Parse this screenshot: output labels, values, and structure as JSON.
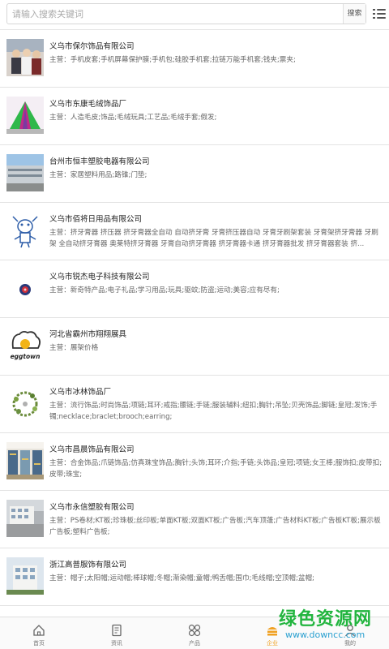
{
  "search": {
    "placeholder": "请输入搜索关键词",
    "button_label": "搜索"
  },
  "menu_icon": "list-menu-icon",
  "desc_prefix": "主营：",
  "companies": [
    {
      "name": "义乌市保尔饰品有限公司",
      "desc": "手机皮套;手机屏幕保护膜;手机包;硅胶手机套;拉链万能手机套;钱夹;票夹;"
    },
    {
      "name": "义乌市东康毛绒饰品厂",
      "desc": "人造毛皮;饰品;毛绒玩具;工艺品;毛绒手套;假发;"
    },
    {
      "name": "台州市恒丰塑胶电器有限公司",
      "desc": "家居塑料用品;路锥;门垫;"
    },
    {
      "name": "义乌市佰将日用品有限公司",
      "desc": "挤牙膏器 挤压器 挤牙膏器全自动 自动挤牙膏 牙膏挤压器自动 牙膏牙刷架套装 牙膏架挤牙膏器 牙刷架 全自动挤牙膏器 奥莱特挤牙膏器 牙膏自动挤牙膏器 挤牙膏器卡通 挤牙膏器批发 挤牙膏器套装 挤..."
    },
    {
      "name": "义乌市锐杰电子科技有限公司",
      "desc": "新奇特产品;电子礼品;学习用品;玩具;驱蚊;防盗;运动;美容;应有尽有;"
    },
    {
      "name": "河北省霸州市翔翔展具",
      "desc": "展架价格"
    },
    {
      "name": "义乌市冰林饰品厂",
      "desc": "流行饰品;时尚饰品;项链;耳环;戒指;腰链;手链;服装辅料;纽扣;胸针;吊坠;贝壳饰品;脚链;皇冠;发饰;手镯;necklace;braclet;brooch;earring;"
    },
    {
      "name": "义乌市昌晨饰品有限公司",
      "desc": "合金饰品;爪链饰品;仿真珠宝饰品;胸针;头饰;耳环;介指;手链;头饰品;皇冠;项链;女王棒;服饰扣;皮带扣;皮带;珠宝;"
    },
    {
      "name": "义乌市永信塑胶有限公司",
      "desc": "PS卷材;KT板;珍珠板;丝印板;单面KT板;双面KT板;广告板;汽车顶蓬;广告材料KT板;广告板KT板;展示板广告板;塑料广告板;"
    },
    {
      "name": "浙江高普服饰有限公司",
      "desc": "帽子;太阳帽;运动帽;棒球帽;冬帽;渐染帽;童帽;鸭舌帽;围巾;毛线帽;空顶帽;盆帽;"
    }
  ],
  "thumbnails": [
    "people-photo",
    "green-tent-photo",
    "factory-building-photo",
    "cartoon-toothpaste-logo",
    "red-gadget-photo",
    "eggtown-logo",
    "jewelry-photo",
    "jewelry-shop-photo",
    "factory-yard-photo",
    "office-building-photo"
  ],
  "eggtown_logo_text": "eggtown",
  "bottom_nav": [
    {
      "label": "首页",
      "icon": "home-icon",
      "active": false
    },
    {
      "label": "资讯",
      "icon": "news-icon",
      "active": false
    },
    {
      "label": "产品",
      "icon": "grid-icon",
      "active": false
    },
    {
      "label": "企业",
      "icon": "building-icon",
      "active": true
    },
    {
      "label": "我的",
      "icon": "person-icon",
      "active": false
    }
  ],
  "watermark": {
    "title": "绿色资源网",
    "url": "www.downcc.com"
  },
  "colors": {
    "accent": "#f0a020",
    "watermark_green": "#22b53f",
    "watermark_blue": "#2aa0d0"
  }
}
